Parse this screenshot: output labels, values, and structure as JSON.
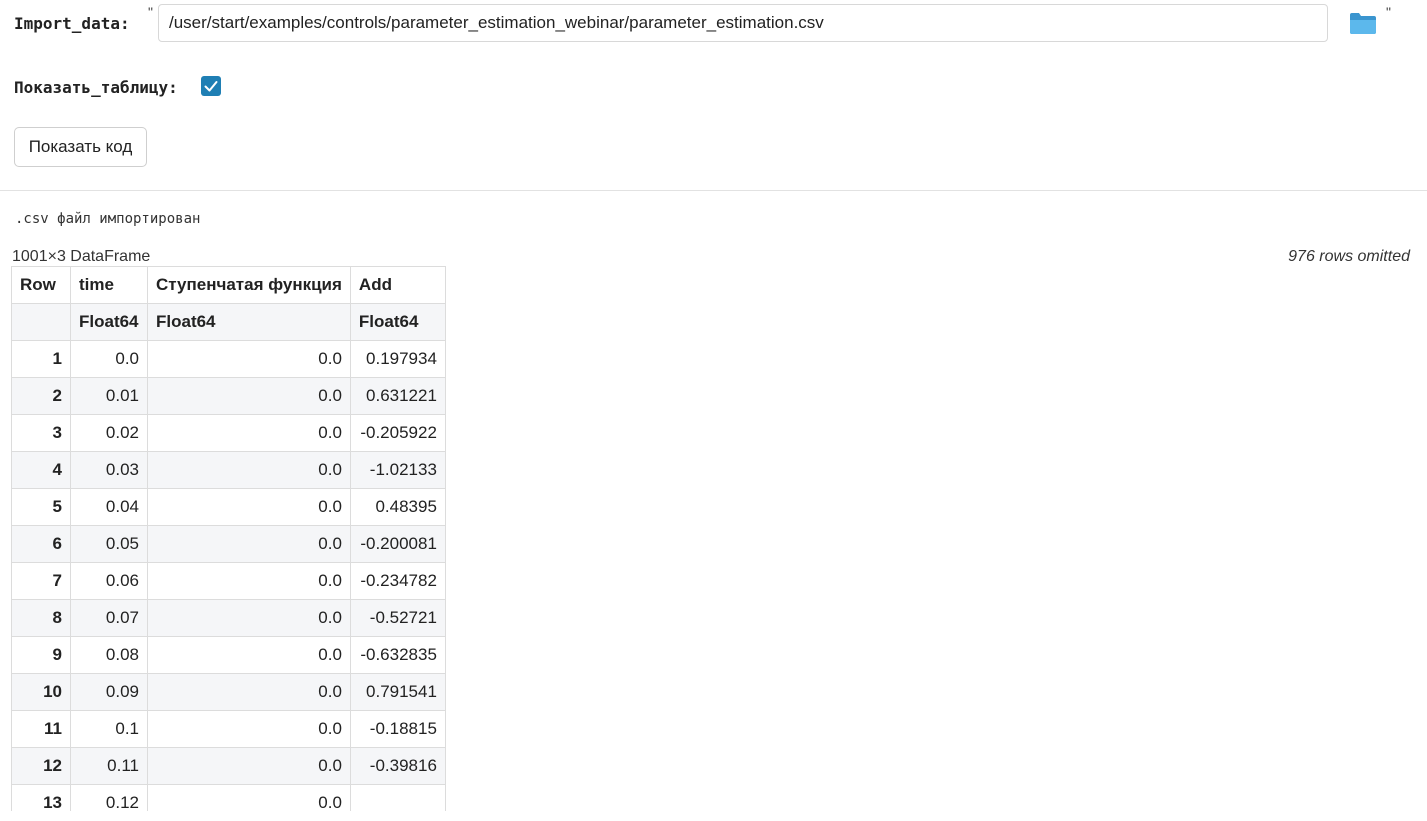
{
  "form": {
    "import": {
      "label": "Import_data:",
      "quote_open": "\"",
      "quote_close": "\"",
      "path_value": "/user/start/examples/controls/parameter_estimation_webinar/parameter_estimation.csv",
      "folder_icon": "folder-icon"
    },
    "show_table": {
      "label": "Показать_таблицу:",
      "checked": true
    },
    "show_code_button": "Показать код"
  },
  "output": {
    "status": ".csv файл импортирован",
    "dataframe_title": "1001×3 DataFrame",
    "rows_omitted": "976 rows omitted",
    "table": {
      "columns": [
        "Row",
        "time",
        "Ступенчатая функция",
        "Add"
      ],
      "types": [
        "",
        "Float64",
        "Float64",
        "Float64"
      ],
      "rows": [
        [
          "1",
          "0.0",
          "0.0",
          "0.197934"
        ],
        [
          "2",
          "0.01",
          "0.0",
          "0.631221"
        ],
        [
          "3",
          "0.02",
          "0.0",
          "-0.205922"
        ],
        [
          "4",
          "0.03",
          "0.0",
          "-1.02133"
        ],
        [
          "5",
          "0.04",
          "0.0",
          "0.48395"
        ],
        [
          "6",
          "0.05",
          "0.0",
          "-0.200081"
        ],
        [
          "7",
          "0.06",
          "0.0",
          "-0.234782"
        ],
        [
          "8",
          "0.07",
          "0.0",
          "-0.52721"
        ],
        [
          "9",
          "0.08",
          "0.0",
          "-0.632835"
        ],
        [
          "10",
          "0.09",
          "0.0",
          "0.791541"
        ],
        [
          "11",
          "0.1",
          "0.0",
          "-0.18815"
        ],
        [
          "12",
          "0.11",
          "0.0",
          "-0.39816"
        ],
        [
          "13",
          "0.12",
          "0.0",
          ""
        ]
      ]
    }
  },
  "colors": {
    "checkbox": "#1f7fb4",
    "folder": "#4aa8e0",
    "stripe": "#f5f6f8",
    "grid": "#dcdcdc"
  }
}
